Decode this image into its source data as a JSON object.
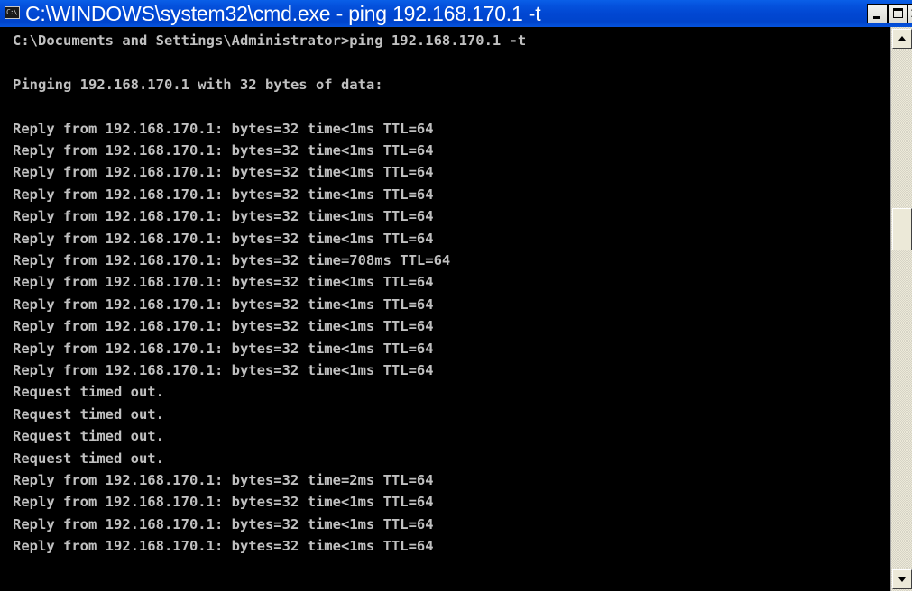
{
  "window": {
    "title": "C:\\WINDOWS\\system32\\cmd.exe - ping 192.168.170.1 -t",
    "icon": "cmd-icon",
    "icon_glyph": "C:\\",
    "title_bar_color": "#0147d2",
    "background_color": "#000000",
    "text_color": "#c0c0c0",
    "controls": {
      "minimize": "minimize-icon",
      "maximize": "maximize-icon",
      "close": "close-icon",
      "close_glyph": "×"
    }
  },
  "console": {
    "lines": [
      "C:\\Documents and Settings\\Administrator>ping 192.168.170.1 -t",
      "",
      "Pinging 192.168.170.1 with 32 bytes of data:",
      "",
      "Reply from 192.168.170.1: bytes=32 time<1ms TTL=64",
      "Reply from 192.168.170.1: bytes=32 time<1ms TTL=64",
      "Reply from 192.168.170.1: bytes=32 time<1ms TTL=64",
      "Reply from 192.168.170.1: bytes=32 time<1ms TTL=64",
      "Reply from 192.168.170.1: bytes=32 time<1ms TTL=64",
      "Reply from 192.168.170.1: bytes=32 time<1ms TTL=64",
      "Reply from 192.168.170.1: bytes=32 time=708ms TTL=64",
      "Reply from 192.168.170.1: bytes=32 time<1ms TTL=64",
      "Reply from 192.168.170.1: bytes=32 time<1ms TTL=64",
      "Reply from 192.168.170.1: bytes=32 time<1ms TTL=64",
      "Reply from 192.168.170.1: bytes=32 time<1ms TTL=64",
      "Reply from 192.168.170.1: bytes=32 time<1ms TTL=64",
      "Request timed out.",
      "Request timed out.",
      "Request timed out.",
      "Request timed out.",
      "Reply from 192.168.170.1: bytes=32 time=2ms TTL=64",
      "Reply from 192.168.170.1: bytes=32 time<1ms TTL=64",
      "Reply from 192.168.170.1: bytes=32 time<1ms TTL=64",
      "Reply from 192.168.170.1: bytes=32 time<1ms TTL=64"
    ]
  },
  "scrollbar": {
    "up_icon": "scroll-up-arrow-icon",
    "down_icon": "scroll-down-arrow-icon"
  }
}
